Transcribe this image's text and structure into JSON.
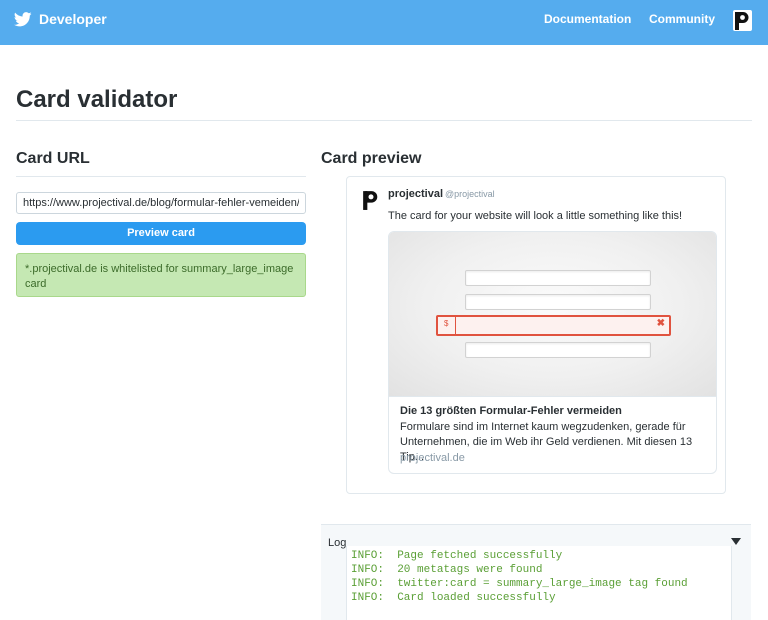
{
  "header": {
    "brand": "Developer",
    "nav": [
      "Documentation",
      "Community"
    ],
    "bar_color": "#55acee",
    "logo_icon": "twitter-bird-icon",
    "avatar_icon": "projectival-p-logo"
  },
  "page": {
    "title": "Card validator"
  },
  "card_url": {
    "heading": "Card URL",
    "input_value": "https://www.projectival.de/blog/formular-fehler-vemeiden/",
    "button_label": "Preview card",
    "button_color": "#2b9bf0",
    "alert_text": "*.projectival.de is whitelisted for summary_large_image card",
    "alert_color": "#c5e8b3"
  },
  "card_preview": {
    "heading": "Card preview",
    "author_name": "projectival",
    "author_handle": "@projectival",
    "tweet_text": "The card for your website will look a little something like this!",
    "card": {
      "title": "Die 13 größten Formular-Fehler vermeiden",
      "description": "Formulare sind im Internet kaum wegzudenken, gerade für Unternehmen, die im Web ihr Geld verdienen. Mit diesen 13 Tip...",
      "domain": "projectival.de",
      "error_color": "#e0533f"
    }
  },
  "log": {
    "label": "Log",
    "lines": [
      "INFO:  Page fetched successfully",
      "INFO:  20 metatags were found",
      "INFO:  twitter:card = summary_large_image tag found",
      "INFO:  Card loaded successfully"
    ],
    "line_color": "#5a9f35"
  }
}
